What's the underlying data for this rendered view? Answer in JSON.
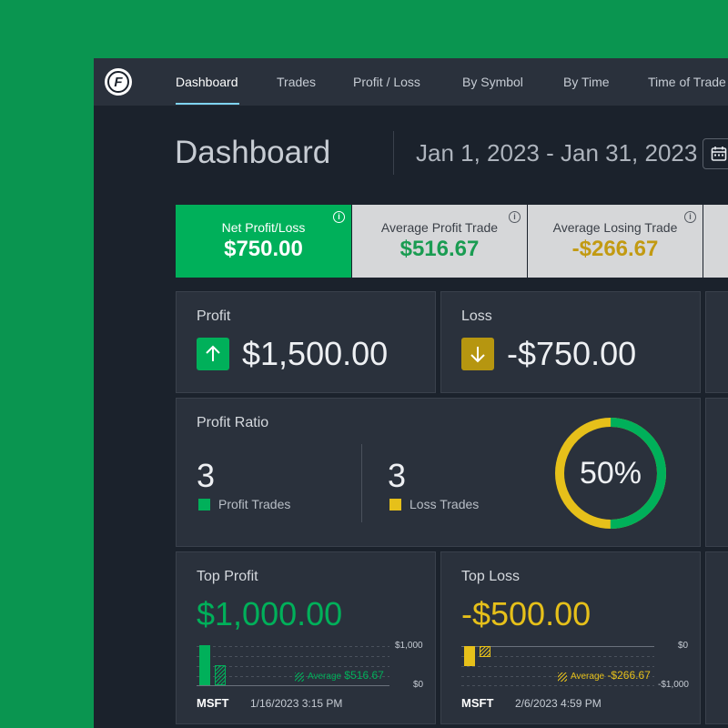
{
  "nav": {
    "tabs": [
      {
        "label": "Dashboard",
        "active": true
      },
      {
        "label": "Trades"
      },
      {
        "label": "Profit / Loss"
      },
      {
        "label": "By Symbol"
      },
      {
        "label": "By Time"
      },
      {
        "label": "Time of Trade"
      }
    ]
  },
  "header": {
    "title": "Dashboard",
    "date_range": "Jan 1, 2023 - Jan 31, 2023"
  },
  "stats": [
    {
      "label": "Net Profit/Loss",
      "value": "$750.00"
    },
    {
      "label": "Average Profit Trade",
      "value": "$516.67"
    },
    {
      "label": "Average Losing Trade",
      "value": "-$266.67"
    }
  ],
  "profit": {
    "title": "Profit",
    "amount": "$1,500.00"
  },
  "loss": {
    "title": "Loss",
    "amount": "-$750.00"
  },
  "ratio": {
    "title": "Profit Ratio",
    "profit_count": "3",
    "profit_label": "Profit Trades",
    "loss_count": "3",
    "loss_label": "Loss Trades",
    "percent_text": "50%",
    "percent": 0.5
  },
  "top_profit": {
    "title": "Top Profit",
    "amount": "$1,000.00",
    "axis_top": "$1,000",
    "axis_bottom": "$0",
    "avg_prefix": "Average",
    "avg_value": "$516.67",
    "symbol": "MSFT",
    "timestamp": "1/16/2023 3:15 PM"
  },
  "top_loss": {
    "title": "Top Loss",
    "amount": "-$500.00",
    "axis_top": "$0",
    "axis_bottom": "-$1,000",
    "avg_prefix": "Average",
    "avg_value": "-$266.67",
    "symbol": "MSFT",
    "timestamp": "2/6/2023 4:59 PM"
  },
  "colors": {
    "green": "#00b05a",
    "yellow": "#e6c01a",
    "gold_text": "#c29a12",
    "panel": "#2a313c",
    "background": "#0a9550"
  },
  "icons": [
    "logo-icon",
    "calendar-icon",
    "info-icon",
    "arrow-up-icon",
    "arrow-down-icon"
  ]
}
